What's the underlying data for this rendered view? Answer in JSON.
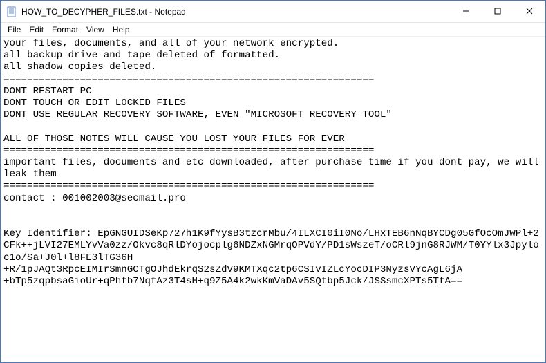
{
  "titlebar": {
    "icon_name": "notepad-icon",
    "title": "HOW_TO_DECYPHER_FILES.txt - Notepad"
  },
  "window_controls": {
    "minimize": "—",
    "maximize": "☐",
    "close": "✕"
  },
  "menu": {
    "file": "File",
    "edit": "Edit",
    "format": "Format",
    "view": "View",
    "help": "Help"
  },
  "body_text": "your files, documents, and all of your network encrypted.\nall backup drive and tape deleted of formatted.\nall shadow copies deleted.\n===============================================================\nDONT RESTART PC\nDONT TOUCH OR EDIT LOCKED FILES\nDONT USE REGULAR RECOVERY SOFTWARE, EVEN \"MICROSOFT RECOVERY TOOL\"\n\nALL OF THOSE NOTES WILL CAUSE YOU LOST YOUR FILES FOR EVER\n===============================================================\nimportant files, documents and etc downloaded, after purchase time if you dont pay, we will leak them\n===============================================================\ncontact : 001002003@secmail.pro\n\n\nKey Identifier: EpGNGUIDSeKp727h1K9fYysB3tzcrMbu/4ILXCI0iI0No/LHxTEB6nNqBYCDg05GfOcOmJWPl+2CFk++jLVI27EMLYvVa0zz/Okvc8qRlDYojocplg6NDZxNGMrqOPVdY/PD1sWszeT/oCRl9jnG8RJWM/T0YYlx3Jpyloc1o/Sa+J0l+l8FE3lTG36H\n+R/1pJAQt3RpcEIMIrSmnGCTgOJhdEkrqS2sZdV9KMTXqc2tp6CSIvIZLcYocDIP3NyzsVYcAgL6jA\n+bTp5zqpbsaGioUr+qPhfb7NqfAz3T4sH+q9Z5A4k2wkKmVaDAv5SQtbp5Jck/JSSsmcXPTs5TfA=="
}
